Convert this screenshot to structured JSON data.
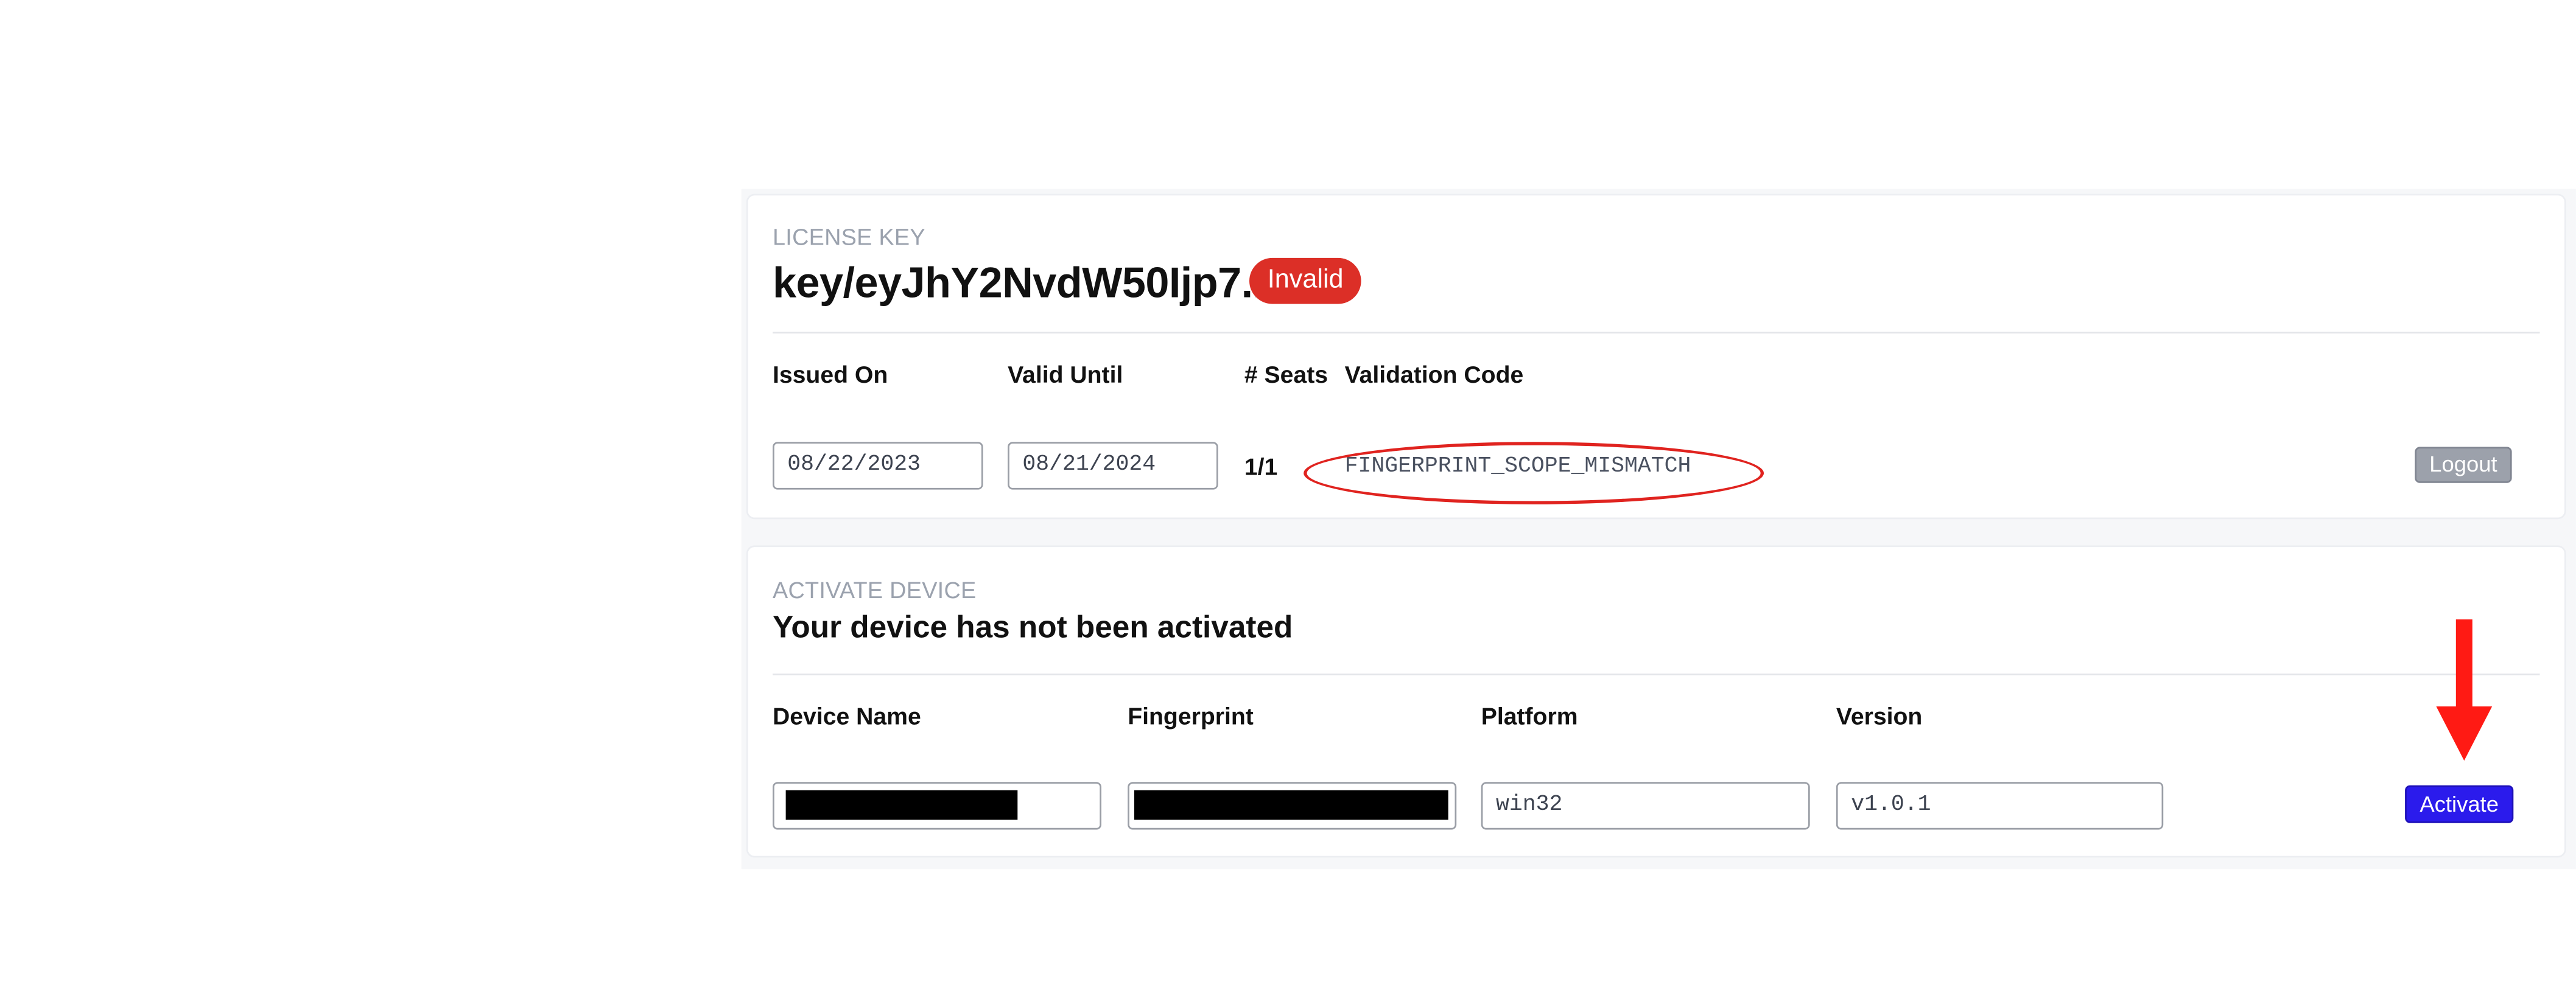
{
  "license": {
    "eyebrow": "LICENSE KEY",
    "key": "key/eyJhY2NvdW50Ijp7...",
    "status": "Invalid",
    "columns": {
      "issued_on": "Issued On",
      "valid_until": "Valid Until",
      "seats": "# Seats",
      "validation_code": "Validation Code"
    },
    "issued_on_value": "08/22/2023",
    "valid_until_value": "08/21/2024",
    "seats_value": "1/1",
    "validation_code_value": "FINGERPRINT_SCOPE_MISMATCH",
    "logout_label": "Logout"
  },
  "device": {
    "eyebrow": "ACTIVATE DEVICE",
    "title": "Your device has not been activated",
    "columns": {
      "device_name": "Device Name",
      "fingerprint": "Fingerprint",
      "platform": "Platform",
      "version": "Version"
    },
    "platform_value": "win32",
    "version_value": "v1.0.1",
    "activate_label": "Activate"
  },
  "colors": {
    "invalid_badge": "#dc2f27",
    "activate_button": "#2b1bec",
    "annotation_red": "#e0231f",
    "logout_button": "#9ca1ab"
  },
  "icons": {
    "annotation": "down-arrow-icon"
  }
}
